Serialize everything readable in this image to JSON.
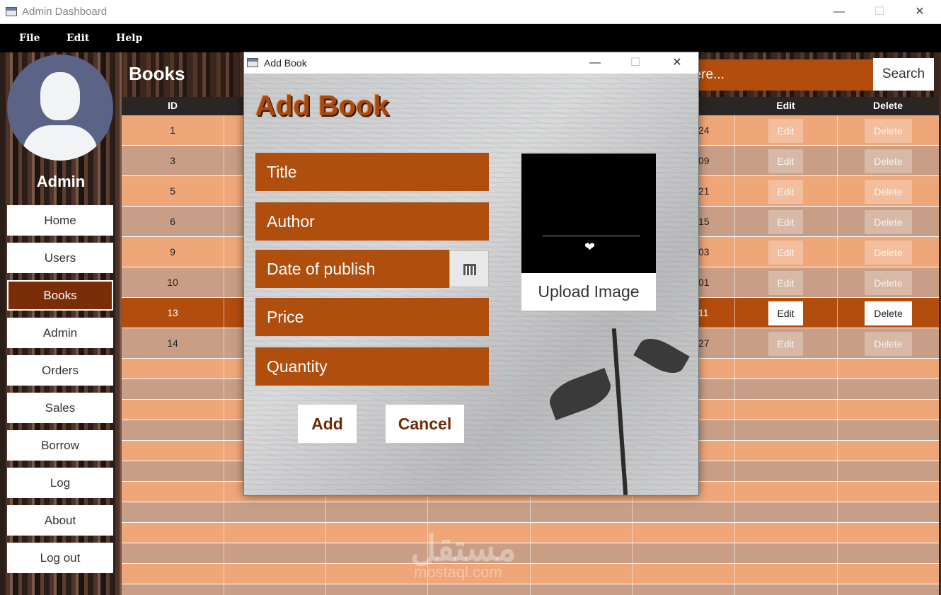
{
  "window": {
    "title": "Admin Dashboard"
  },
  "menu": [
    "File",
    "Edit",
    "Help"
  ],
  "sidebar": {
    "user_name": "Admin",
    "items": [
      {
        "label": "Home"
      },
      {
        "label": "Users"
      },
      {
        "label": "Books",
        "active": true
      },
      {
        "label": "Admin"
      },
      {
        "label": "Orders"
      },
      {
        "label": "Sales"
      },
      {
        "label": "Borrow"
      },
      {
        "label": "Log"
      },
      {
        "label": "About"
      },
      {
        "label": "Log out"
      }
    ]
  },
  "main": {
    "page_title": "Books",
    "search": {
      "placeholder": "here...",
      "button": "Search"
    },
    "table": {
      "columns": {
        "id": "ID",
        "edit": "Edit",
        "delete": "Delete"
      },
      "rows": [
        {
          "id": "1",
          "date": "24",
          "edit": "Edit",
          "delete": "Delete"
        },
        {
          "id": "3",
          "date": "09",
          "edit": "Edit",
          "delete": "Delete"
        },
        {
          "id": "5",
          "date": "21",
          "edit": "Edit",
          "delete": "Delete"
        },
        {
          "id": "6",
          "date": "15",
          "edit": "Edit",
          "delete": "Delete"
        },
        {
          "id": "9",
          "date": "03",
          "edit": "Edit",
          "delete": "Delete"
        },
        {
          "id": "10",
          "date": "01",
          "edit": "Edit",
          "delete": "Delete"
        },
        {
          "id": "13",
          "date": "11",
          "edit": "Edit",
          "delete": "Delete",
          "selected": true
        },
        {
          "id": "14",
          "date": "27",
          "edit": "Edit",
          "delete": "Delete"
        }
      ]
    },
    "watermark": {
      "arabic": "مستقل",
      "latin": "mostaql.com"
    }
  },
  "dialog": {
    "title": "Add Book",
    "heading": "Add Book",
    "fields": {
      "title": "Title",
      "author": "Author",
      "date": "Date of publish",
      "price": "Price",
      "quantity": "Quantity"
    },
    "upload_button": "Upload Image",
    "add_button": "Add",
    "cancel_button": "Cancel"
  },
  "colors": {
    "accent": "#b04e0e",
    "dark_accent": "#7a2e07",
    "row": "#efa679",
    "row_alt": "#c99e86",
    "header": "#2b2523"
  }
}
